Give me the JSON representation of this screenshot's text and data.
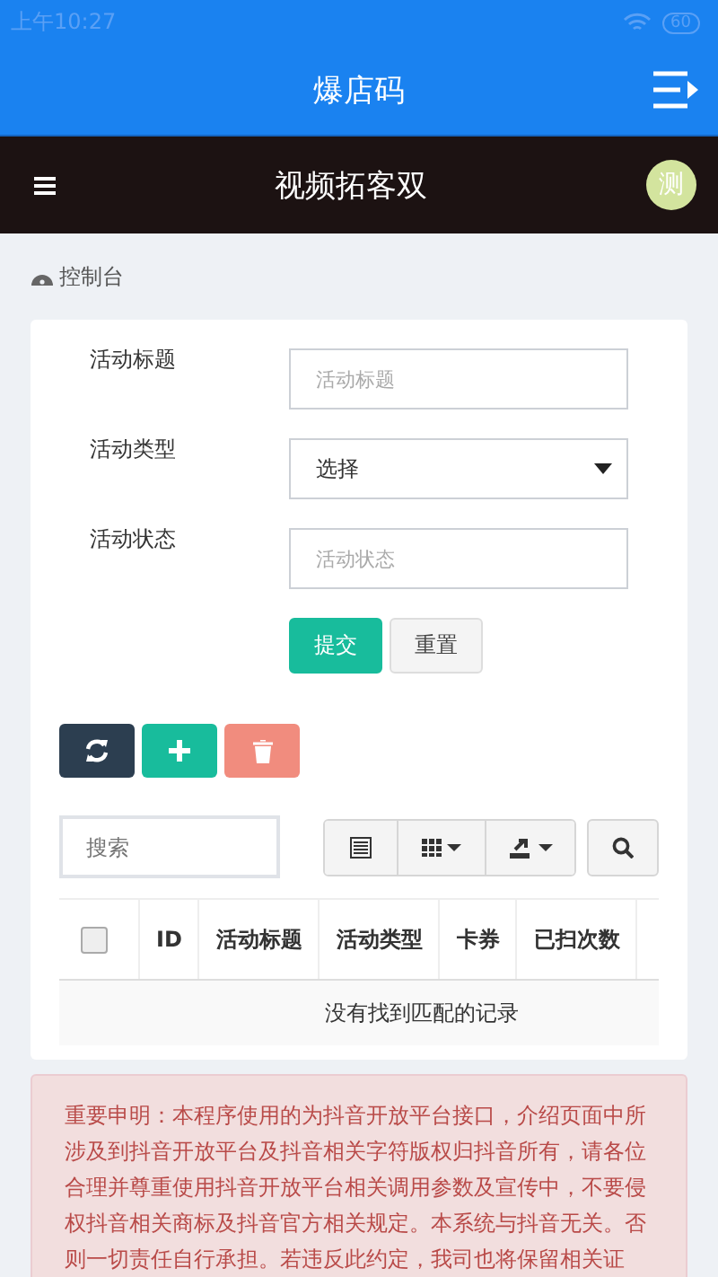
{
  "status_bar": {
    "time": "上午10:27",
    "battery": "60"
  },
  "app_bar": {
    "title": "爆店码"
  },
  "header": {
    "title": "视频拓客双",
    "avatar": "测"
  },
  "breadcrumb": "控制台",
  "form": {
    "fields": [
      {
        "label": "活动标题",
        "kind": "text",
        "placeholder": "活动标题"
      },
      {
        "label": "活动类型",
        "kind": "select",
        "value": "选择"
      },
      {
        "label": "活动状态",
        "kind": "text",
        "placeholder": "活动状态"
      }
    ],
    "buttons": [
      "提交",
      "重置"
    ]
  },
  "search": {
    "placeholder": "搜索"
  },
  "table": {
    "select_all": {
      "checked": false
    },
    "columns": [
      "ID",
      "活动标题",
      "活动类型",
      "卡券",
      "已扫次数"
    ],
    "empty_message": "没有找到匹配的记录"
  },
  "notice": "重要申明：本程序使用的为抖音开放平台接口，介绍页面中所涉及到抖音开放平台及抖音相关字符版权归抖音所有，请各位合理并尊重使用抖音开放平台相关调用参数及宣传中，不要侵权抖音相关商标及抖音官方相关规定。本系统与抖音无关。否则一切责任自行承担。若违反此约定，我司也将保留相关证"
}
